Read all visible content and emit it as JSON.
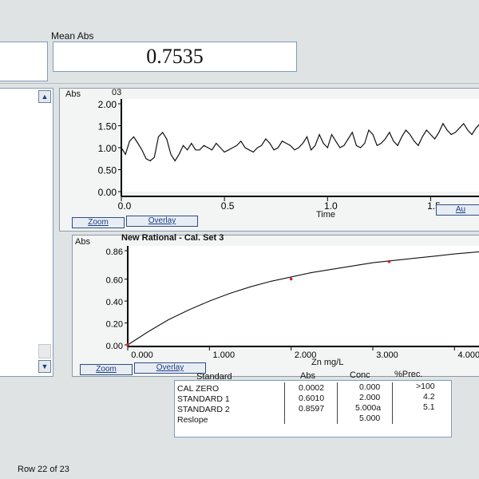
{
  "header": {
    "mean_abs_label": "Mean Abs",
    "mean_abs_value": "0.7535"
  },
  "time_chart": {
    "ylabel": "Abs",
    "id_label": "03",
    "xlabel": "Time",
    "zoom_label": "Zoom",
    "overlay_label": "Overlay",
    "y_ticks": [
      "2.00",
      "1.50",
      "1.00",
      "0.50",
      "0.00"
    ],
    "x_ticks": [
      "0.0",
      "0.5",
      "1.0",
      "1.5"
    ]
  },
  "cal_chart": {
    "ylabel": "Abs",
    "title": "New Rational - Cal. Set 3",
    "xlabel": "Zn mg/L",
    "zoom_label": "Zoom",
    "overlay_label": "Overlay",
    "y_ticks": [
      "0.86",
      "0.60",
      "0.40",
      "0.20",
      "0.00"
    ],
    "x_ticks": [
      "0.000",
      "1.000",
      "2.000",
      "3.000",
      "4.000"
    ]
  },
  "table": {
    "headers": {
      "standard": "Standard",
      "abs": "Abs",
      "conc": "Conc",
      "prec": "%Prec."
    },
    "rows": [
      {
        "standard": "CAL ZERO",
        "abs": "0.0002",
        "conc": "0.000",
        "prec": ">100"
      },
      {
        "standard": "STANDARD 1",
        "abs": "0.6010",
        "conc": "2.000",
        "prec": "4.2"
      },
      {
        "standard": "STANDARD 2",
        "abs": "0.8597",
        "conc": "5.000a",
        "prec": "5.1"
      },
      {
        "standard": "Reslope",
        "abs": "",
        "conc": "5.000",
        "prec": ""
      }
    ]
  },
  "status": {
    "row_text": "Row 22 of 23"
  },
  "chart_data": [
    {
      "type": "line",
      "xlabel": "Time",
      "ylabel": "Abs",
      "xlim": [
        0.0,
        1.75
      ],
      "ylim": [
        0.0,
        2.0
      ],
      "x": [
        0.0,
        0.02,
        0.04,
        0.06,
        0.08,
        0.1,
        0.12,
        0.14,
        0.16,
        0.18,
        0.2,
        0.22,
        0.24,
        0.26,
        0.28,
        0.3,
        0.32,
        0.34,
        0.36,
        0.38,
        0.4,
        0.42,
        0.44,
        0.46,
        0.48,
        0.5,
        0.52,
        0.54,
        0.56,
        0.58,
        0.6,
        0.62,
        0.64,
        0.66,
        0.68,
        0.7,
        0.72,
        0.74,
        0.76,
        0.78,
        0.8,
        0.82,
        0.84,
        0.86,
        0.88,
        0.9,
        0.92,
        0.94,
        0.96,
        0.98,
        1.0,
        1.02,
        1.04,
        1.06,
        1.08,
        1.1,
        1.12,
        1.14,
        1.16,
        1.18,
        1.2,
        1.22,
        1.24,
        1.26,
        1.28,
        1.3,
        1.32,
        1.34,
        1.36,
        1.38,
        1.4,
        1.42,
        1.44,
        1.46,
        1.48,
        1.5,
        1.52,
        1.54,
        1.56,
        1.58,
        1.6,
        1.62,
        1.64,
        1.66,
        1.68,
        1.7,
        1.72,
        1.74
      ],
      "y": [
        1.0,
        0.85,
        1.15,
        1.25,
        1.1,
        0.95,
        0.75,
        0.7,
        0.78,
        1.25,
        1.35,
        1.2,
        0.85,
        0.7,
        0.85,
        1.05,
        0.95,
        1.1,
        0.95,
        0.95,
        1.05,
        1.0,
        0.95,
        1.1,
        1.0,
        0.9,
        0.95,
        1.0,
        1.05,
        1.15,
        1.0,
        0.95,
        0.9,
        1.0,
        1.05,
        1.2,
        1.1,
        0.95,
        1.0,
        1.15,
        1.1,
        1.05,
        0.95,
        1.0,
        1.1,
        1.25,
        0.95,
        1.05,
        1.3,
        1.1,
        1.0,
        1.3,
        1.15,
        1.0,
        1.05,
        1.2,
        1.35,
        1.05,
        1.0,
        1.1,
        1.4,
        1.3,
        1.05,
        1.1,
        1.2,
        1.35,
        1.15,
        1.05,
        1.25,
        1.4,
        1.3,
        1.15,
        1.05,
        1.25,
        1.4,
        1.3,
        1.2,
        1.35,
        1.55,
        1.4,
        1.3,
        1.35,
        1.45,
        1.55,
        1.4,
        1.3,
        1.45,
        1.55
      ]
    },
    {
      "type": "line",
      "title": "New Rational - Cal. Set 3",
      "xlabel": "Zn mg/L",
      "ylabel": "Abs",
      "xlim": [
        0.0,
        4.3
      ],
      "ylim": [
        0.0,
        0.86
      ],
      "x": [
        0.0,
        0.25,
        0.5,
        0.75,
        1.0,
        1.25,
        1.5,
        1.75,
        2.0,
        2.25,
        2.5,
        2.75,
        3.0,
        3.25,
        3.5,
        3.75,
        4.0,
        4.3
      ],
      "y": [
        0.0,
        0.12,
        0.23,
        0.32,
        0.4,
        0.47,
        0.53,
        0.58,
        0.62,
        0.66,
        0.69,
        0.72,
        0.75,
        0.77,
        0.79,
        0.81,
        0.83,
        0.85
      ],
      "points": [
        {
          "x": 0.0,
          "y": 0.0002
        },
        {
          "x": 2.0,
          "y": 0.601
        },
        {
          "x": 3.2,
          "y": 0.76
        }
      ]
    }
  ]
}
